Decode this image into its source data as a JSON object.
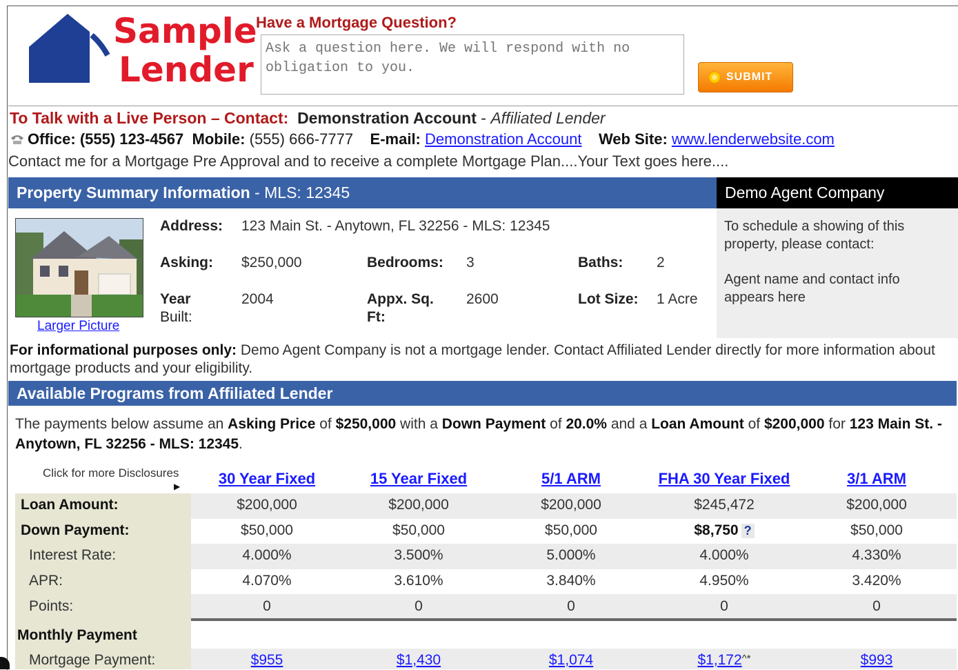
{
  "header": {
    "logo_line1": "Sample",
    "logo_line2": "Lender",
    "question_label": "Have a Mortgage Question?",
    "question_placeholder": "Ask a question here. We will respond with no obligation to you.",
    "submit_label": "SUBMIT"
  },
  "contact": {
    "talk_label": "To Talk with a Live Person – Contact:",
    "contact_name": "Demonstration Account",
    "separator": " - ",
    "lender_type": "Affiliated Lender",
    "office_label": "Office:",
    "office_value": "(555) 123-4567",
    "mobile_label": "Mobile:",
    "mobile_value": "(555) 666-7777",
    "email_label": "E-mail:",
    "email_value": "Demonstration Account",
    "website_label": "Web Site:",
    "website_value": "www.lenderwebsite.com",
    "tagline": "Contact me for a Mortgage Pre Approval and to receive a complete Mortgage Plan....Your Text goes here...."
  },
  "property": {
    "bar_title": "Property Summary Information",
    "bar_mls": " - MLS: 12345",
    "agent_company": "Demo Agent Company",
    "larger_picture": "Larger Picture",
    "address_label": "Address:",
    "address_value": "123 Main St. - Anytown, FL 32256 - MLS: 12345",
    "asking_label": "Asking:",
    "asking_value": "$250,000",
    "bedrooms_label": "Bedrooms:",
    "bedrooms_value": "3",
    "baths_label": "Baths:",
    "baths_value": "2",
    "year_label_1": "Year",
    "year_label_2": "Built:",
    "year_value": "2004",
    "sqft_label_1": "Appx. Sq.",
    "sqft_label_2": "Ft:",
    "sqft_value": "2600",
    "lot_label": "Lot Size:",
    "lot_value": "1 Acre",
    "agent_text_1": "To schedule a showing of this property, please contact:",
    "agent_text_2": "Agent name and contact info appears here"
  },
  "info": {
    "bold": "For informational purposes only:",
    "text": " Demo Agent Company is not a mortgage lender. Contact Affiliated Lender directly for more information about mortgage products and your eligibility."
  },
  "programs": {
    "bar_title": "Available Programs from Affiliated Lender",
    "assume_1": "The payments below assume an ",
    "assume_b1": "Asking Price",
    "assume_2": " of ",
    "assume_b2": "$250,000",
    "assume_3": " with a ",
    "assume_b3": "Down Payment",
    "assume_4": " of ",
    "assume_b4": "20.0%",
    "assume_5": " and a ",
    "assume_b5": "Loan Amount",
    "assume_6": " of ",
    "assume_b6": "$200,000",
    "assume_7": " for ",
    "assume_b7": "123 Main St. - Anytown, FL 32256 - MLS: 12345",
    "assume_8": ".",
    "disclosures": "Click for more Disclosures",
    "columns": [
      "30 Year Fixed",
      "15 Year Fixed",
      "5/1 ARM",
      "FHA 30 Year Fixed",
      "3/1 ARM"
    ],
    "rows": {
      "loan_amount": {
        "label": "Loan Amount:",
        "values": [
          "$200,000",
          "$200,000",
          "$200,000",
          "$245,472",
          "$200,000"
        ]
      },
      "down_payment": {
        "label": "Down Payment:",
        "values": [
          "$50,000",
          "$50,000",
          "$50,000",
          "$8,750",
          "$50,000"
        ]
      },
      "interest_rate": {
        "label": "Interest Rate:",
        "values": [
          "4.000%",
          "3.500%",
          "5.000%",
          "4.000%",
          "4.330%"
        ]
      },
      "apr": {
        "label": "APR:",
        "values": [
          "4.070%",
          "3.610%",
          "3.840%",
          "4.950%",
          "3.420%"
        ]
      },
      "points": {
        "label": "Points:",
        "values": [
          "0",
          "0",
          "0",
          "0",
          "0"
        ]
      },
      "monthly_payment": {
        "label": "Monthly Payment"
      },
      "mortgage_payment": {
        "label": "Mortgage Payment:",
        "values": [
          "$955",
          "$1,430",
          "$1,074",
          "$1,172",
          "$993"
        ],
        "fha_suffix": "^*"
      }
    },
    "help_icon": "?"
  }
}
